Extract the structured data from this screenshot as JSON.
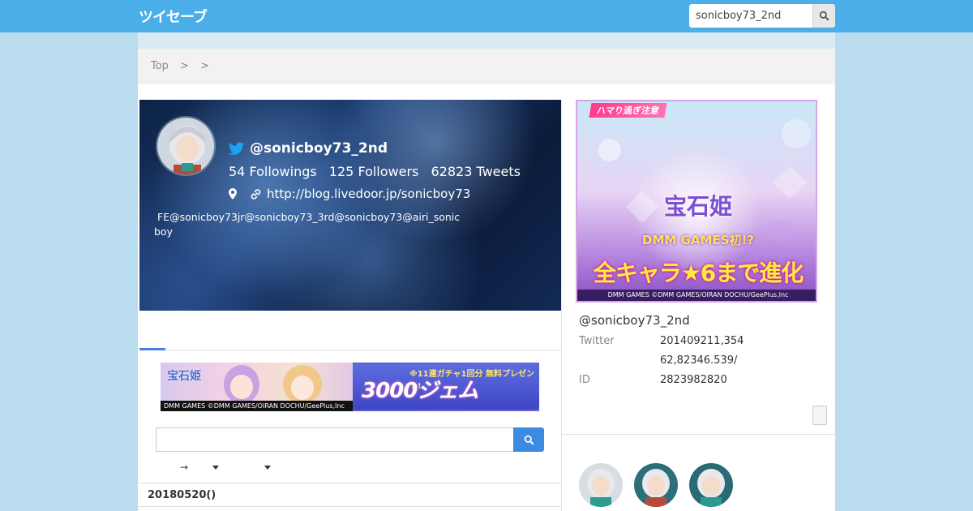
{
  "header": {
    "logo_text": "ツイセーブ",
    "search_value": "sonicboy73_2nd",
    "search_icon": "search-icon"
  },
  "breadcrumb": {
    "items": [
      "Top",
      ">",
      ">"
    ]
  },
  "profile": {
    "handle": "@sonicboy73_2nd",
    "stats": {
      "followings": "54 Followings",
      "followers": "125 Followers",
      "tweets": "62823 Tweets"
    },
    "url": "http://blog.livedoor.jp/sonicboy73",
    "bio": "FE@sonicboy73jr@sonicboy73_3rd@sonicboy73@airi_sonicboy"
  },
  "banner": {
    "brand": "宝石姫",
    "gem_text": "3000ジェム",
    "promo_text": "※11連ガチャ1回分 無料プレゼント!",
    "footer": "DMM GAMES ©DMM GAMES/OIRAN DOCHU/GeePlus,Inc"
  },
  "filters": {
    "arrow": "→"
  },
  "date_heading": "20180520()",
  "sidebar": {
    "ad": {
      "top_label": "ハマり過ぎ注意",
      "title": "宝石姫",
      "subtitle": "DMM GAMES初!?",
      "headline": "全キャラ★6まで進化",
      "footer": "DMM GAMES ©DMM GAMES/OIRAN DOCHU/GeePlus,Inc"
    },
    "handle": "@sonicboy73_2nd",
    "info": [
      {
        "key": "Twitter",
        "value": "201409211,354"
      },
      {
        "key": "",
        "value": "62,82346.539/"
      },
      {
        "key": "ID",
        "value": "2823982820"
      }
    ]
  },
  "colors": {
    "topbar": "#4aaee8",
    "page_bg": "#b9dcef",
    "accent": "#3b8ce0"
  }
}
